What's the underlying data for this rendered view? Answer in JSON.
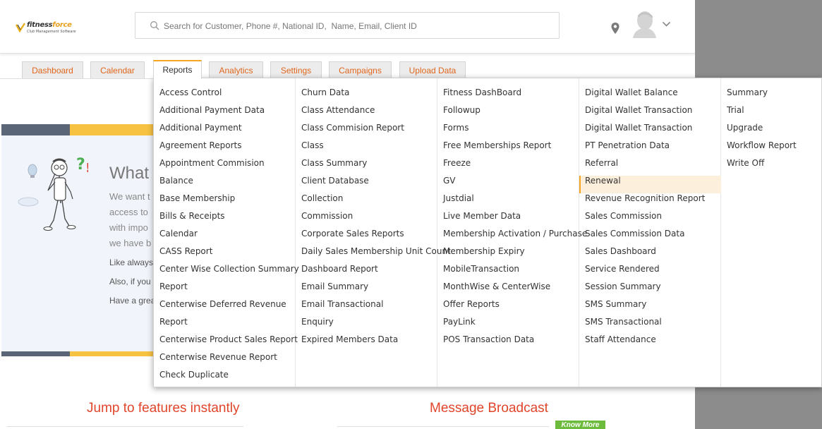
{
  "header": {
    "logo_brand_prefix": "fitness",
    "logo_brand_suffix": "force",
    "logo_tagline": "Club Management Software",
    "search_placeholder": "Search for Customer, Phone #, National ID,  Name, Email, Client ID"
  },
  "tabs": [
    {
      "label": "Dashboard"
    },
    {
      "label": "Calendar"
    },
    {
      "label": "Reports",
      "active": true
    },
    {
      "label": "Analytics"
    },
    {
      "label": "Settings"
    },
    {
      "label": "Campaigns"
    },
    {
      "label": "Upload Data"
    }
  ],
  "welcome": {
    "title": "What",
    "body": [
      "We want t",
      "access to",
      "with impo",
      "we have b"
    ],
    "line1": "Like always",
    "line2": "Also, if you",
    "line3": "Have a grea"
  },
  "features": {
    "jump_heading": "Jump to features instantly",
    "broadcast_heading": "Message Broadcast",
    "know_more": "Know More"
  },
  "reports_menu": {
    "columns": [
      [
        "Access Control",
        "Additional Payment Data",
        "Additional Payment",
        "Agreement Reports",
        "Appointment Commision",
        "Balance",
        "Base Membership",
        "Bills & Receipts",
        "Calendar",
        "CASS Report",
        "Center Wise Collection Summary",
        "Report",
        "Centerwise Deferred Revenue",
        "Report",
        "Centerwise Product Sales Report",
        "Centerwise Revenue Report",
        "Check Duplicate"
      ],
      [
        "Churn Data",
        "Class Attendance",
        "Class Commision Report",
        "Class",
        "Class Summary",
        "Client Database",
        "Collection",
        "Commission",
        "Corporate Sales Reports",
        "Daily Sales Membership Unit Count",
        "Dashboard Report",
        "Email Summary",
        "Email Transactional",
        "Enquiry",
        "Expired Members Data"
      ],
      [
        "Fitness DashBoard",
        "Followup",
        "Forms",
        "Free Memberships Report",
        "Freeze",
        "GV",
        "Justdial",
        "Live Member Data",
        "Membership Activation / Purchase",
        "Membership Expiry",
        "MobileTransaction",
        "MonthWise & CenterWise",
        "Offer Reports",
        "PayLink",
        "POS Transaction Data"
      ],
      [
        "Digital Wallet Balance",
        "Digital Wallet Transaction",
        "Digital Wallet Transaction",
        "PT Penetration Data",
        "Referral",
        "Renewal",
        "Revenue Recognition Report",
        "Sales Commission",
        "Sales Commission Data",
        "Sales Dashboard",
        "Service Rendered",
        "Session Summary",
        "SMS Summary",
        "SMS Transactional",
        "Staff Attendance"
      ],
      [
        "Summary",
        "Trial",
        "Upgrade",
        "Workflow Report",
        "Write Off"
      ]
    ],
    "highlighted": "Renewal"
  },
  "colors": {
    "accent_orange": "#f5a623",
    "tab_text": "#e0651c",
    "heading_red": "#e0452a",
    "stripe_slate": "#5a6577",
    "stripe_yellow": "#f7c142",
    "know_more_green": "#6cbb3c"
  },
  "icons": [
    "search-icon",
    "location-pin-icon",
    "user-avatar-icon",
    "chevron-down-icon",
    "fitnessforce-logo-icon"
  ]
}
